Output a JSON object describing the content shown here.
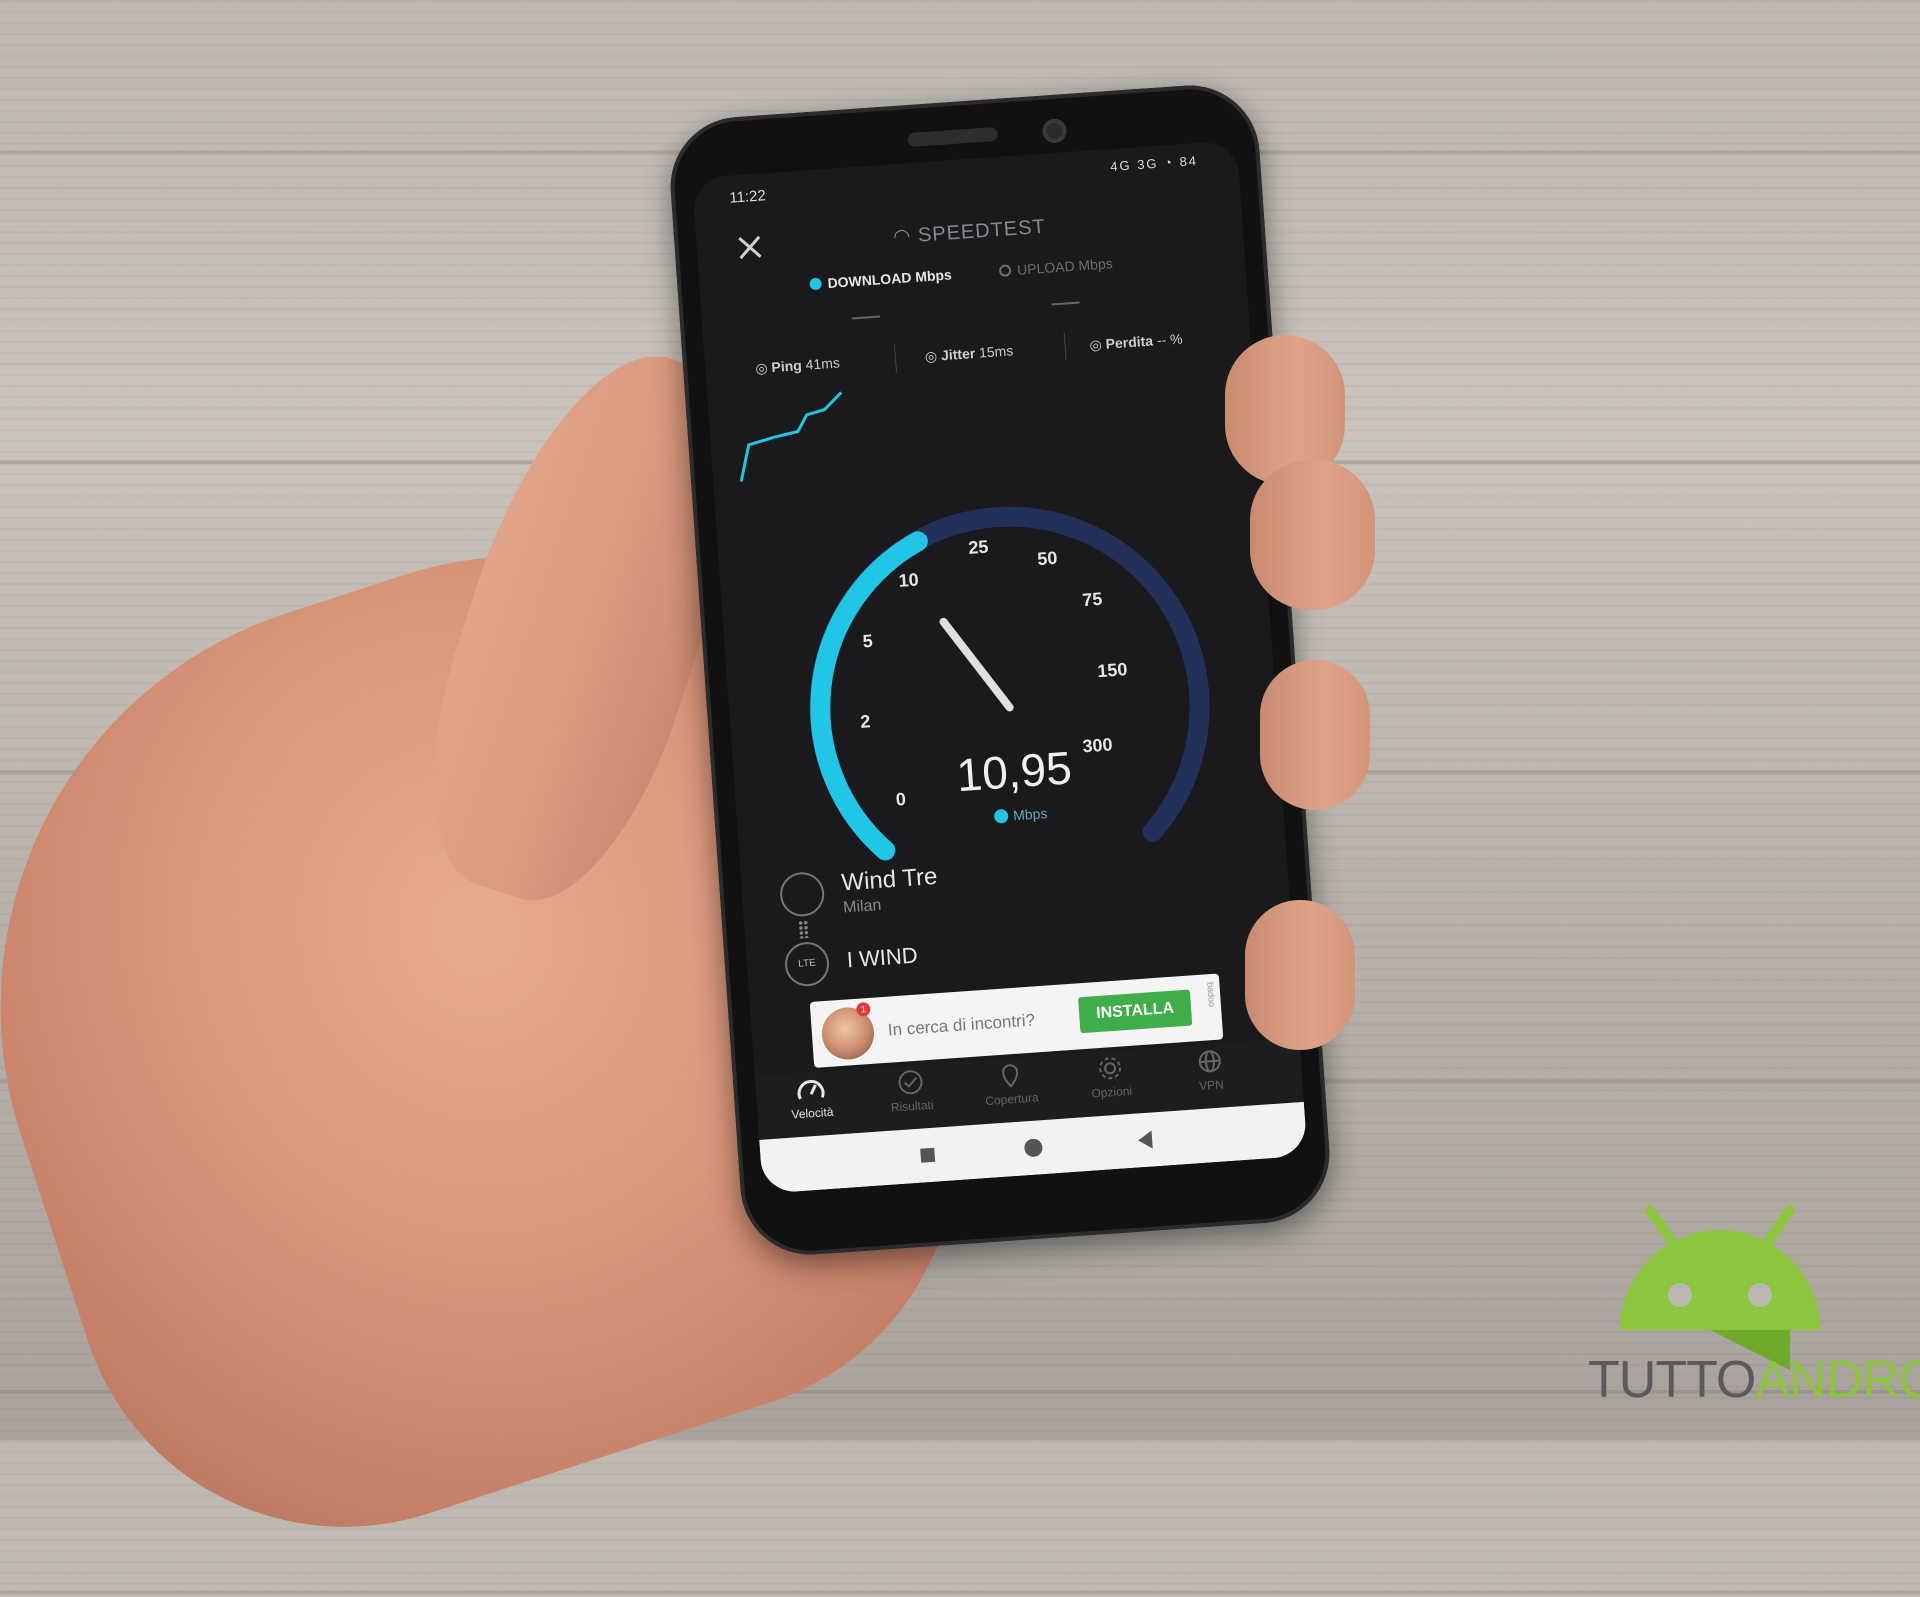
{
  "phone": {
    "status": {
      "time": "11:22",
      "network": "4G 3G",
      "battery": "84"
    },
    "header": {
      "title": "SPEEDTEST",
      "download_label": "DOWNLOAD Mbps",
      "upload_label": "UPLOAD Mbps"
    },
    "metrics": {
      "ping_label": "Ping",
      "ping_value": "41ms",
      "jitter_label": "Jitter",
      "jitter_value": "15ms",
      "loss_label": "Perdita",
      "loss_value": "-- %"
    },
    "gauge": {
      "ticks": [
        "0",
        "2",
        "5",
        "10",
        "25",
        "50",
        "75",
        "150",
        "300"
      ],
      "reading": "10,95",
      "unit": "Mbps"
    },
    "network": {
      "provider": "Wind Tre",
      "city": "Milan",
      "lte_badge": "LTE",
      "carrier": "I WIND"
    },
    "ad": {
      "badge": "1",
      "text": "In cerca di incontri?",
      "button": "INSTALLA",
      "brand": "badoo"
    },
    "nav": {
      "items": [
        "Velocità",
        "Risultati",
        "Copertura",
        "Opzioni",
        "VPN"
      ]
    }
  },
  "watermark": {
    "part1": "TUTTO",
    "part2": "ANDROID"
  },
  "colors": {
    "accent_cyan": "#1fc6e6",
    "gauge_track": "#23305a",
    "install_green": "#3fae49",
    "logo_green": "#8cc63e"
  }
}
